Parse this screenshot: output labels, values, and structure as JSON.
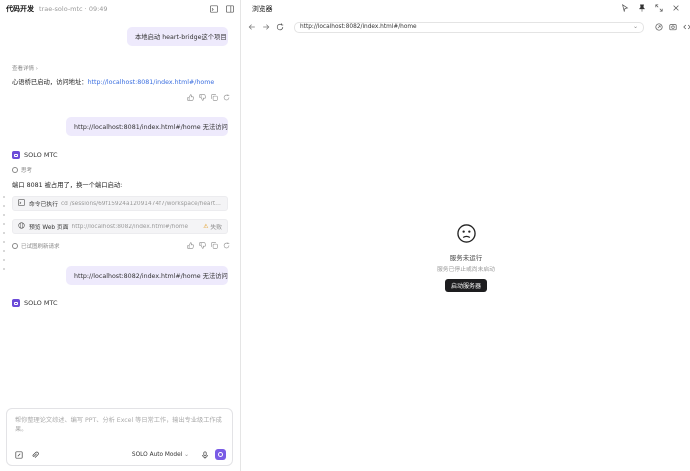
{
  "left_header": {
    "title": "代码开发",
    "subtitle": "trae-solo-mtc · 09:49"
  },
  "messages": {
    "user1": "本地启动 heart-bridge这个项目",
    "details_label": "查看详情",
    "assistant1_text": "心语桥已启动，访问地址：",
    "assistant1_link": "http://localhost:8081/index.html#/home",
    "user2": "http://localhost:8081/index.html#/home 无法访问",
    "brand_name_1": "SOLO MTC",
    "thinking_label": "思考",
    "assistant2_text": "端口 8081 被占用了，换一个端口启动:",
    "cmd_label": "命令已执行",
    "cmd_value": "cd /sessions/69f15924a12091474f7/workspace/heart-bridge...",
    "preview_label": "预览 Web 页面",
    "preview_url": "http://localhost:8082/index.html#/home",
    "preview_status": "失败",
    "interrupted_label": "已试图刷新请求",
    "user3": "http://localhost:8082/index.html#/home 无法访问",
    "brand_name_2": "SOLO MTC"
  },
  "composer": {
    "placeholder": "帮你整理论文综述、编写 PPT、分析 Excel 等日常工作，输出专业级工作成果。",
    "model": "SOLO Auto Model"
  },
  "browser": {
    "title": "浏览器",
    "url": "http://localhost:8082/index.html#/home",
    "status_title": "服务未运行",
    "status_sub": "服务已停止或尚未启动",
    "start_button": "启动服务器"
  }
}
